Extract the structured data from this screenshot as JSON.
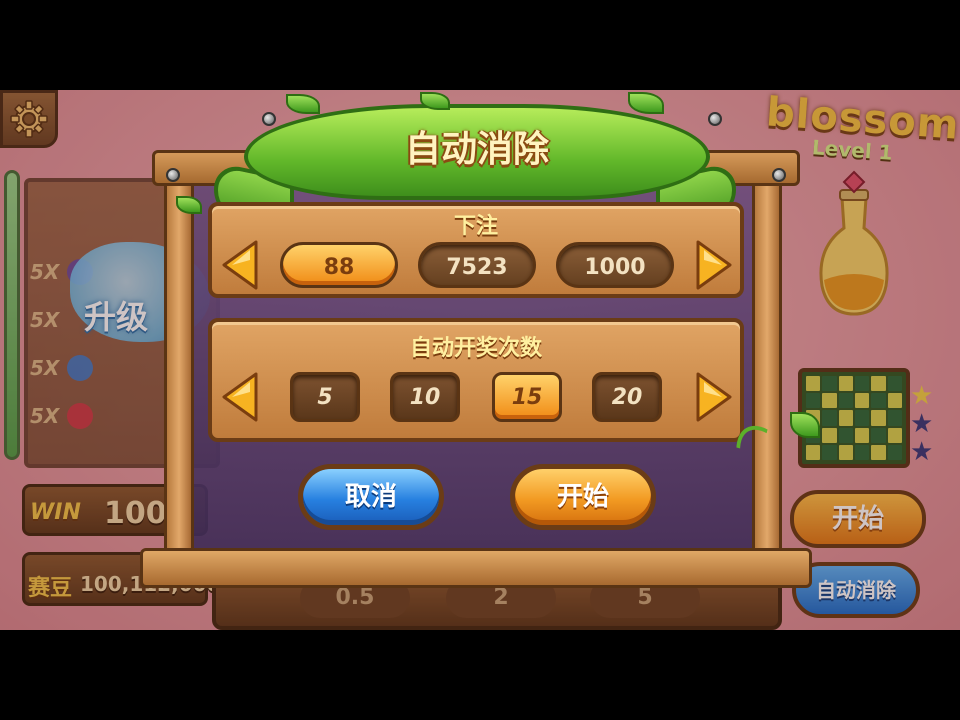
{
  "background": {
    "left_multipliers": [
      "5X",
      "5X",
      "5X",
      "5X"
    ],
    "upgrade_text": "升级",
    "win_label": "WIN",
    "win_value": "1000",
    "bean_label": "赛豆",
    "bean_value": "100,112,000",
    "logo_title": "blossom",
    "logo_level": "Level 1",
    "start_label": "开始",
    "auto_label": "自动消除",
    "bottom_bets": [
      "0.5",
      "2",
      "5"
    ]
  },
  "dialog": {
    "title": "自动消除",
    "bet_section": {
      "title": "下注",
      "options": [
        {
          "label": "88",
          "selected": true
        },
        {
          "label": "7523",
          "selected": false
        },
        {
          "label": "1000",
          "selected": false
        }
      ]
    },
    "count_section": {
      "title": "自动开奖次数",
      "options": [
        {
          "label": "5",
          "selected": false
        },
        {
          "label": "10",
          "selected": false
        },
        {
          "label": "15",
          "selected": true
        },
        {
          "label": "20",
          "selected": false
        }
      ]
    },
    "cancel_label": "取消",
    "start_label": "开始"
  },
  "colors": {
    "selected_option": "#f08a14",
    "unselected_option": "#654020",
    "cancel_button": "#2780e0",
    "start_button": "#f29a22",
    "banner_green": "#62b82a"
  },
  "icons": [
    "gear-icon",
    "arrow-left-icon",
    "arrow-right-icon",
    "potion-icon",
    "star-icon"
  ]
}
